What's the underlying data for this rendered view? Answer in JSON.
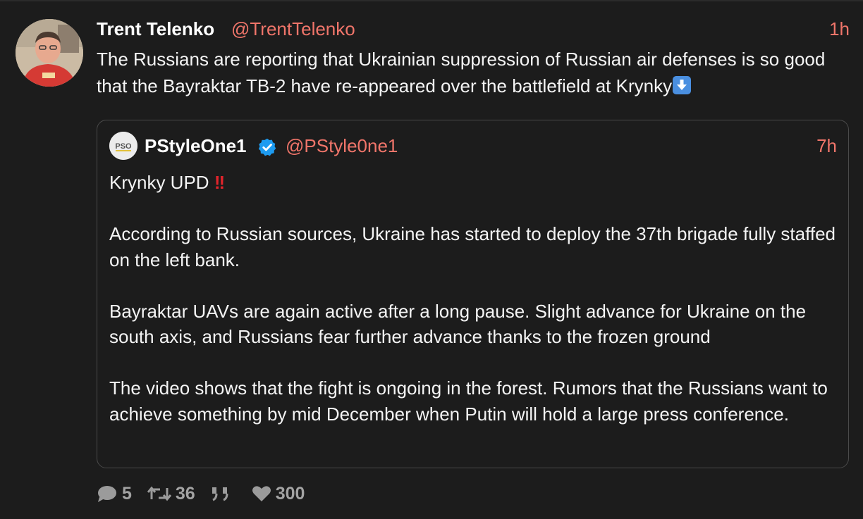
{
  "tweet": {
    "author": {
      "name": "Trent Telenko",
      "handle": "@TrentTelenko",
      "time": "1h",
      "avatar_icon": "profile-photo"
    },
    "text": "The Russians are reporting that Ukrainian suppression of Russian air defenses is so good that the Bayraktar TB-2 have re-appeared over the battlefield at Krynky",
    "emoji_icon": "down-arrow-emoji"
  },
  "quote": {
    "author": {
      "name": "PStyleOne1",
      "handle": "@PStyle0ne1",
      "time": "7h",
      "verified": true,
      "avatar_icon": "pso-logo"
    },
    "headline": "Krynky UPD",
    "headline_marks": "!!",
    "paragraphs": [
      "According to Russian sources, Ukraine has started to deploy the 37th brigade fully staffed on the left bank.",
      "Bayraktar UAVs are again active after a long pause. Slight advance for Ukraine on the south axis, and Russians fear further advance thanks to the frozen ground",
      "The video shows that the fight is ongoing in the forest. Rumors that the Russians want to achieve something by mid December when Putin will hold a large press conference."
    ]
  },
  "actions": {
    "replies": "5",
    "retweets": "36",
    "quotes_icon": "quote-icon",
    "likes": "300"
  },
  "colors": {
    "background": "#1c1c1c",
    "accent": "#f0756a",
    "border": "#4a4a4a",
    "muted": "#9b9b9b",
    "verified": "#1d9bf0"
  }
}
